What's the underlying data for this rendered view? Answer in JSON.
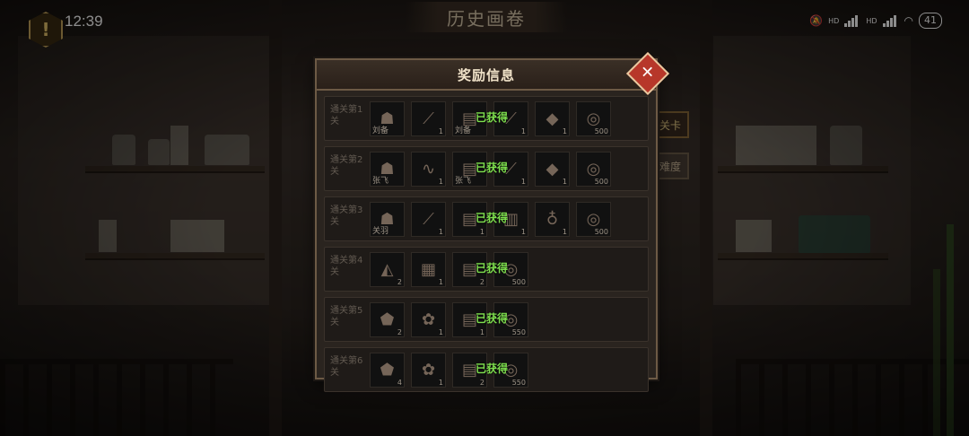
{
  "status_bar": {
    "time": "12:39",
    "warning_icon": "!",
    "net_label_1": "HD",
    "net_label_2": "HD",
    "battery": "41"
  },
  "header": {
    "title": "历史画卷"
  },
  "side_buttons": {
    "stage": "关卡",
    "difficulty": "难度"
  },
  "modal": {
    "title": "奖励信息",
    "close_icon": "✕",
    "obtained_label": "已获得",
    "rows": [
      {
        "label": "通关第1关",
        "slots": [
          {
            "icon": "general",
            "name": "刘备",
            "count": ""
          },
          {
            "icon": "sword",
            "name": "",
            "count": "1"
          },
          {
            "icon": "scroll",
            "name": "刘备",
            "count": ""
          },
          {
            "icon": "spear",
            "name": "",
            "count": "1"
          },
          {
            "icon": "ore",
            "name": "",
            "count": "1"
          },
          {
            "icon": "coin",
            "name": "",
            "count": "500"
          }
        ]
      },
      {
        "label": "通关第2关",
        "slots": [
          {
            "icon": "general",
            "name": "张飞",
            "count": ""
          },
          {
            "icon": "whip",
            "name": "",
            "count": "1"
          },
          {
            "icon": "scroll",
            "name": "张飞",
            "count": ""
          },
          {
            "icon": "spear",
            "name": "",
            "count": "1"
          },
          {
            "icon": "ore",
            "name": "",
            "count": "1"
          },
          {
            "icon": "coin",
            "name": "",
            "count": "500"
          }
        ]
      },
      {
        "label": "通关第3关",
        "slots": [
          {
            "icon": "general",
            "name": "关羽",
            "count": ""
          },
          {
            "icon": "blade",
            "name": "",
            "count": "1"
          },
          {
            "icon": "scroll",
            "name": "",
            "count": "1"
          },
          {
            "icon": "armor",
            "name": "",
            "count": "1"
          },
          {
            "icon": "gourd",
            "name": "",
            "count": "1"
          },
          {
            "icon": "coin",
            "name": "",
            "count": "500"
          }
        ]
      },
      {
        "label": "通关第4关",
        "slots": [
          {
            "icon": "cloak",
            "name": "",
            "count": "2"
          },
          {
            "icon": "shirt",
            "name": "",
            "count": "1"
          },
          {
            "icon": "scroll",
            "name": "",
            "count": "2"
          },
          {
            "icon": "coin",
            "name": "",
            "count": "500"
          }
        ]
      },
      {
        "label": "通关第5关",
        "slots": [
          {
            "icon": "stone",
            "name": "",
            "count": "2"
          },
          {
            "icon": "herb",
            "name": "",
            "count": "1"
          },
          {
            "icon": "scroll",
            "name": "",
            "count": "1"
          },
          {
            "icon": "coin",
            "name": "",
            "count": "550"
          }
        ]
      },
      {
        "label": "通关第6关",
        "slots": [
          {
            "icon": "stone",
            "name": "",
            "count": "4"
          },
          {
            "icon": "herb",
            "name": "",
            "count": "1"
          },
          {
            "icon": "scroll",
            "name": "",
            "count": "2"
          },
          {
            "icon": "coin",
            "name": "",
            "count": "550"
          }
        ]
      }
    ]
  }
}
